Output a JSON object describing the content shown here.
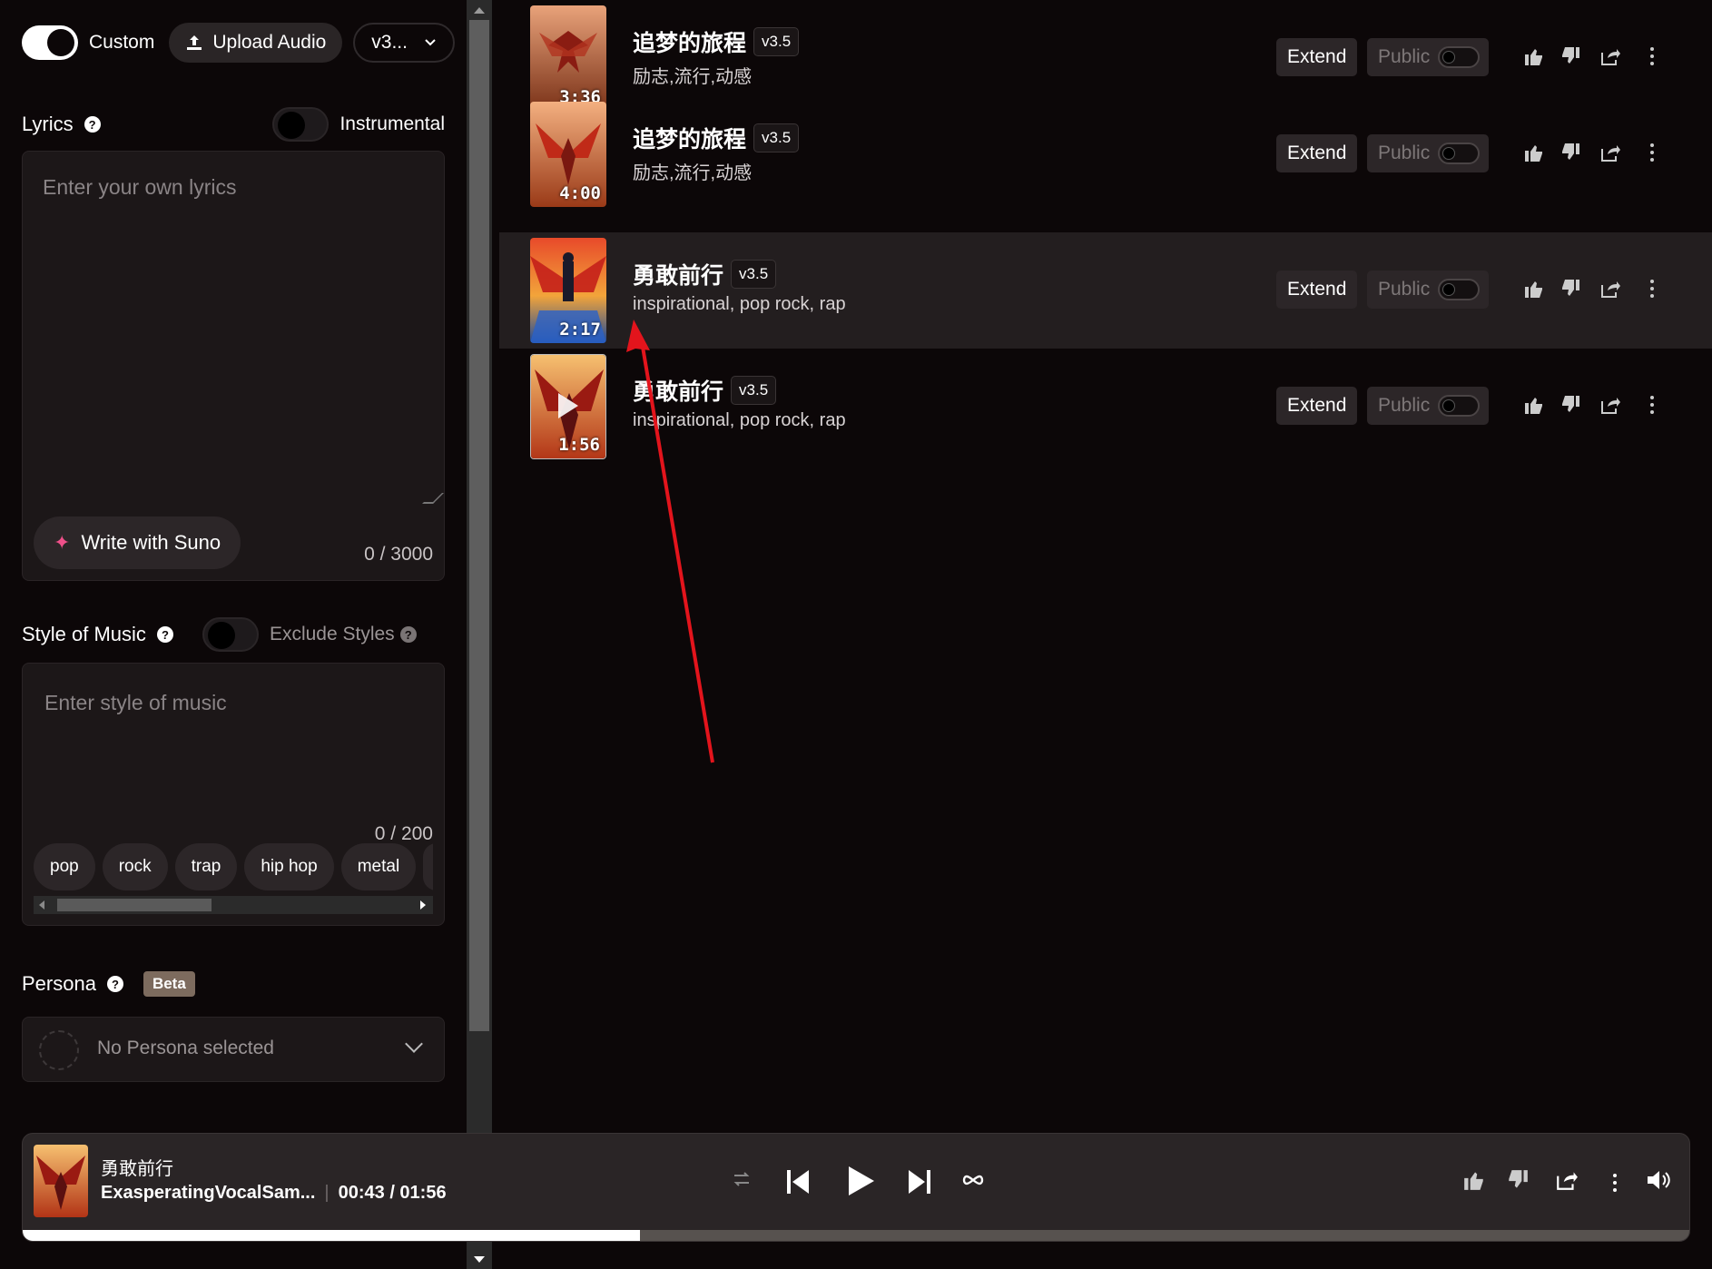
{
  "sidebar": {
    "custom_label": "Custom",
    "upload_label": "Upload Audio",
    "model_label": "v3...",
    "lyrics_title": "Lyrics",
    "instrumental_label": "Instrumental",
    "lyrics_placeholder": "Enter your own lyrics",
    "write_with_suno": "Write with Suno",
    "lyrics_counter": "0 / 3000",
    "style_title": "Style of Music",
    "exclude_label": "Exclude Styles",
    "style_placeholder": "Enter style of music",
    "style_counter": "0 / 200",
    "style_tags": [
      "pop",
      "rock",
      "trap",
      "hip hop",
      "metal"
    ],
    "persona_title": "Persona",
    "beta_label": "Beta",
    "persona_placeholder": "No Persona selected"
  },
  "songs": [
    {
      "title": "追梦的旅程",
      "version": "v3.5",
      "tags": "励志,流行,动感",
      "duration": "3:36",
      "active": false,
      "extend": "Extend",
      "public": "Public"
    },
    {
      "title": "追梦的旅程",
      "version": "v3.5",
      "tags": "励志,流行,动感",
      "duration": "4:00",
      "active": false,
      "extend": "Extend",
      "public": "Public"
    },
    {
      "title": "勇敢前行",
      "version": "v3.5",
      "tags": "inspirational, pop rock, rap",
      "duration": "2:17",
      "active": true,
      "extend": "Extend",
      "public": "Public"
    },
    {
      "title": "勇敢前行",
      "version": "v3.5",
      "tags": "inspirational, pop rock, rap",
      "duration": "1:56",
      "active": false,
      "extend": "Extend",
      "public": "Public"
    }
  ],
  "player": {
    "title": "勇敢前行",
    "artist": "ExasperatingVocalSam...",
    "separator": "|",
    "time": "00:43 / 01:56",
    "progress": 0.37
  },
  "icons": {
    "upload": "upload-icon",
    "help": "help-icon",
    "chevron": "chevron-down-icon",
    "sparkle": "sparkle-icon",
    "thumbs_up": "thumbs-up-icon",
    "thumbs_down": "thumbs-down-icon",
    "share": "share-icon",
    "more": "more-icon",
    "repeat": "repeat-icon",
    "previous": "previous-icon",
    "play": "play-icon",
    "next": "next-icon",
    "loop": "loop-icon",
    "volume": "volume-icon"
  },
  "colors": {
    "accent_arrow": "#e3141c",
    "background": "#0c0708"
  }
}
